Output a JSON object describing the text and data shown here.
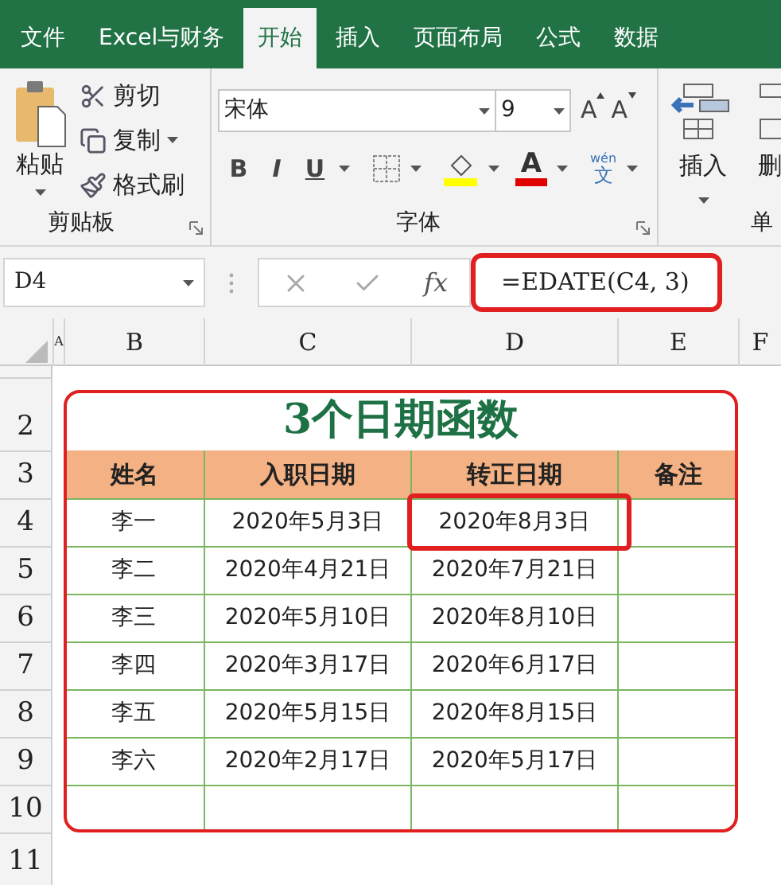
{
  "tabs": [
    {
      "label": "文件",
      "selected": false
    },
    {
      "label": "Excel与财务",
      "selected": false
    },
    {
      "label": "开始",
      "selected": true
    },
    {
      "label": "插入",
      "selected": false
    },
    {
      "label": "页面布局",
      "selected": false
    },
    {
      "label": "公式",
      "selected": false
    },
    {
      "label": "数据",
      "selected": false
    }
  ],
  "ribbon": {
    "clipboard": {
      "paste": "粘贴",
      "items": [
        {
          "kind": "cut",
          "label": "剪切"
        },
        {
          "kind": "copy",
          "label": "复制"
        },
        {
          "kind": "painter",
          "label": "格式刷"
        }
      ],
      "label": "剪贴板"
    },
    "font": {
      "font_name": "宋体",
      "font_size": "9",
      "grow": "A",
      "shrink": "A",
      "format_buttons": [
        "B",
        "I",
        "U"
      ],
      "font_color_label": "A",
      "phonetic_top": "wén",
      "phonetic_bottom": "文",
      "label": "字体"
    },
    "cells": {
      "insert": "插入",
      "delete": "删",
      "label": "单"
    }
  },
  "formula_bar": {
    "name_box": "D4",
    "fx": "fx",
    "formula": "=EDATE(C4, 3)",
    "highlighted": true
  },
  "columns": [
    "A",
    "B",
    "C",
    "D",
    "E",
    "F"
  ],
  "rows": [
    "2",
    "3",
    "4",
    "5",
    "6",
    "7",
    "8",
    "9",
    "10",
    "11"
  ],
  "sheet": {
    "title": "3个日期函数",
    "headers": [
      "姓名",
      "入职日期",
      "转正日期",
      "备注"
    ],
    "data": [
      {
        "cells": [
          "李一",
          "2020年5月3日",
          "2020年8月3日"
        ],
        "highlighted": true
      },
      {
        "cells": [
          "李二",
          "2020年4月21日",
          "2020年7月21日"
        ],
        "highlighted": false
      },
      {
        "cells": [
          "李三",
          "2020年5月10日",
          "2020年8月10日"
        ],
        "highlighted": false
      },
      {
        "cells": [
          "李四",
          "2020年3月17日",
          "2020年6月17日"
        ],
        "highlighted": false
      },
      {
        "cells": [
          "李五",
          "2020年5月15日",
          "2020年8月15日"
        ],
        "highlighted": false
      },
      {
        "cells": [
          "李六",
          "2020年2月17日",
          "2020年5月17日"
        ],
        "highlighted": false
      }
    ]
  }
}
